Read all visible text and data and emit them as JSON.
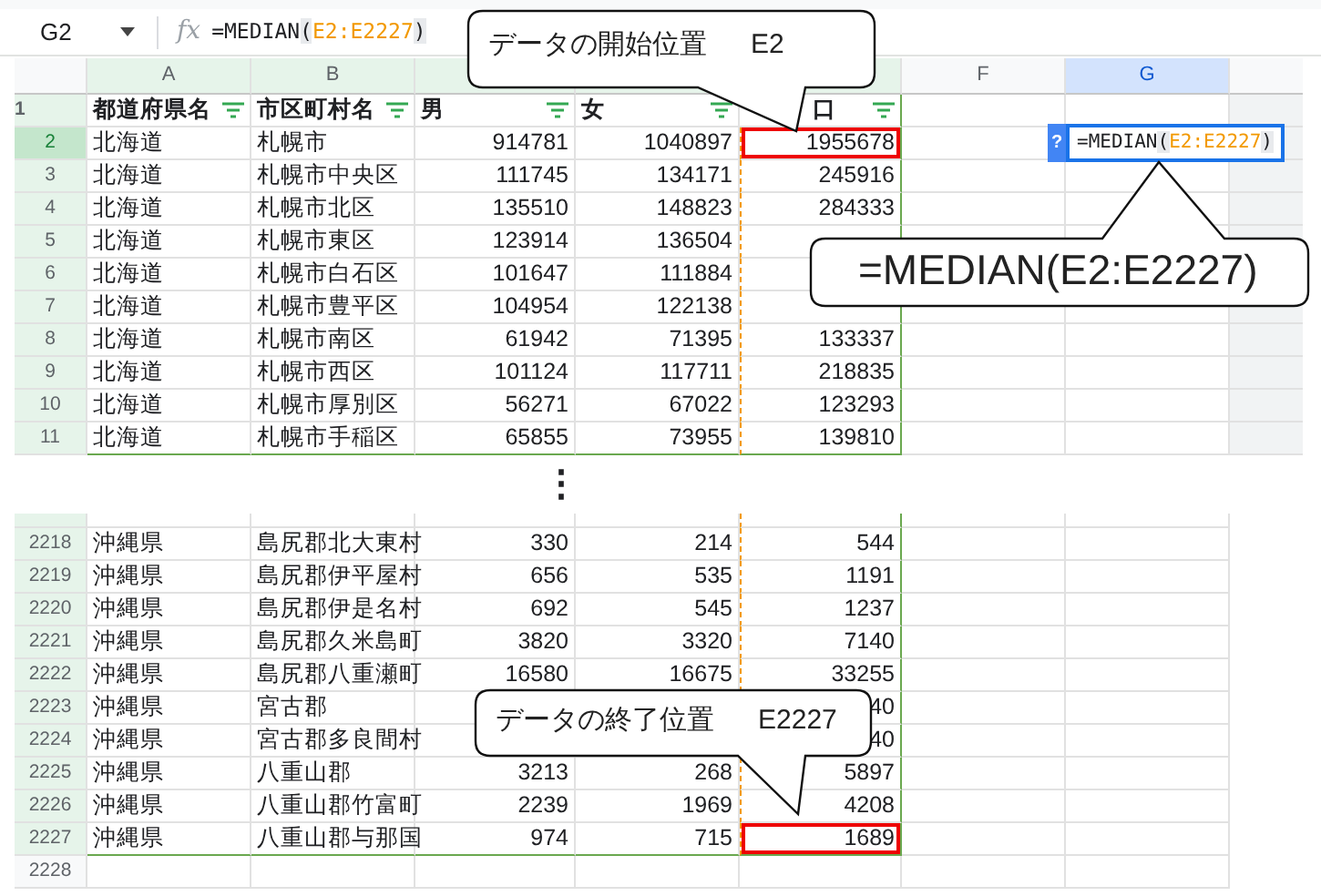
{
  "formula_bar": {
    "cell_ref": "G2",
    "fx": "fx",
    "formula": [
      {
        "text": "=MEDIAN",
        "kind": "plain"
      },
      {
        "text": "(",
        "kind": "paren"
      },
      {
        "text": "E2:E2227",
        "kind": "range"
      },
      {
        "text": ")",
        "kind": "paren"
      }
    ]
  },
  "sheet": {
    "columns": [
      {
        "letter": "A",
        "kind": "text",
        "filter": true,
        "selected": false,
        "in_range": false
      },
      {
        "letter": "B",
        "kind": "text",
        "filter": true,
        "selected": false,
        "in_range": false
      },
      {
        "kind": "number",
        "filter": true,
        "selected": false,
        "in_range": false
      },
      {
        "kind": "number",
        "filter": true,
        "selected": false,
        "in_range": false
      },
      {
        "kind": "number",
        "filter": true,
        "selected": false,
        "in_range": true
      },
      {
        "letter": "F",
        "kind": "text",
        "filter": false,
        "selected": false,
        "in_range": false
      },
      {
        "letter": "G",
        "kind": "text",
        "filter": false,
        "selected": true,
        "in_range": false
      }
    ],
    "upper_rows": [
      {
        "row": "1",
        "kind": "header",
        "selected": false,
        "filtered": true,
        "in_range": false,
        "target": false,
        "cells": [
          "都道府県名",
          "市区町村名",
          "男",
          "女",
          "口",
          null,
          null
        ]
      },
      {
        "row": "2",
        "kind": "data",
        "selected": true,
        "filtered": true,
        "in_range": true,
        "target": true,
        "cells": [
          "北海道",
          "札幌市",
          "914781",
          "1040897",
          "1955678",
          null,
          null
        ],
        "editor": {
          "hint": "?",
          "formula": [
            {
              "text": "=MEDIAN",
              "kind": "plain"
            },
            {
              "text": "(",
              "kind": "paren"
            },
            {
              "text": "E2:E2227",
              "kind": "range"
            },
            {
              "text": ")",
              "kind": "paren"
            }
          ]
        }
      },
      {
        "row": "3",
        "kind": "data",
        "selected": false,
        "filtered": true,
        "in_range": true,
        "target": false,
        "cells": [
          "北海道",
          "札幌市中央区",
          "111745",
          "134171",
          "245916",
          null,
          null
        ]
      },
      {
        "row": "4",
        "kind": "data",
        "selected": false,
        "filtered": true,
        "in_range": true,
        "target": false,
        "cells": [
          "北海道",
          "札幌市北区",
          "135510",
          "148823",
          "284333",
          null,
          null
        ]
      },
      {
        "row": "5",
        "kind": "data",
        "selected": false,
        "filtered": true,
        "in_range": true,
        "target": false,
        "cells": [
          "北海道",
          "札幌市東区",
          "123914",
          "136504",
          null,
          null,
          null
        ]
      },
      {
        "row": "6",
        "kind": "data",
        "selected": false,
        "filtered": true,
        "in_range": true,
        "target": false,
        "cells": [
          "北海道",
          "札幌市白石区",
          "101647",
          "111884",
          null,
          null,
          null
        ]
      },
      {
        "row": "7",
        "kind": "data",
        "selected": false,
        "filtered": true,
        "in_range": true,
        "target": false,
        "cells": [
          "北海道",
          "札幌市豊平区",
          "104954",
          "122138",
          null,
          null,
          null
        ]
      },
      {
        "row": "8",
        "kind": "data",
        "selected": false,
        "filtered": true,
        "in_range": true,
        "target": false,
        "cells": [
          "北海道",
          "札幌市南区",
          "61942",
          "71395",
          "133337",
          null,
          null
        ]
      },
      {
        "row": "9",
        "kind": "data",
        "selected": false,
        "filtered": true,
        "in_range": true,
        "target": false,
        "cells": [
          "北海道",
          "札幌市西区",
          "101124",
          "117711",
          "218835",
          null,
          null
        ]
      },
      {
        "row": "10",
        "kind": "data",
        "selected": false,
        "filtered": true,
        "in_range": true,
        "target": false,
        "cells": [
          "北海道",
          "札幌市厚別区",
          "56271",
          "67022",
          "123293",
          null,
          null
        ]
      },
      {
        "row": "11",
        "kind": "data",
        "selected": false,
        "filtered": true,
        "in_range": true,
        "target": false,
        "cells": [
          "北海道",
          "札幌市手稲区",
          "65855",
          "73955",
          "139810",
          null,
          null
        ]
      }
    ],
    "gap_mark": "⋮",
    "lower_rows": [
      {
        "row": "2218",
        "kind": "data",
        "selected": false,
        "filtered": true,
        "in_range": true,
        "target": false,
        "cells": [
          "沖縄県",
          "島尻郡北大東村",
          "330",
          "214",
          "544",
          null,
          null
        ]
      },
      {
        "row": "2219",
        "kind": "data",
        "selected": false,
        "filtered": true,
        "in_range": true,
        "target": false,
        "cells": [
          "沖縄県",
          "島尻郡伊平屋村",
          "656",
          "535",
          "1191",
          null,
          null
        ]
      },
      {
        "row": "2220",
        "kind": "data",
        "selected": false,
        "filtered": true,
        "in_range": true,
        "target": false,
        "cells": [
          "沖縄県",
          "島尻郡伊是名村",
          "692",
          "545",
          "1237",
          null,
          null
        ]
      },
      {
        "row": "2221",
        "kind": "data",
        "selected": false,
        "filtered": true,
        "in_range": true,
        "target": false,
        "cells": [
          "沖縄県",
          "島尻郡久米島町",
          "3820",
          "3320",
          "7140",
          null,
          null
        ]
      },
      {
        "row": "2222",
        "kind": "data",
        "selected": false,
        "filtered": true,
        "in_range": true,
        "target": false,
        "cells": [
          "沖縄県",
          "島尻郡八重瀬町",
          "16580",
          "16675",
          "33255",
          null,
          null
        ]
      },
      {
        "row": "2223",
        "kind": "data",
        "selected": false,
        "filtered": true,
        "in_range": true,
        "target": false,
        "cells": [
          "沖縄県",
          "宮古郡",
          null,
          null,
          "40",
          null,
          null
        ]
      },
      {
        "row": "2224",
        "kind": "data",
        "selected": false,
        "filtered": true,
        "in_range": true,
        "target": false,
        "cells": [
          "沖縄県",
          "宮古郡多良間村",
          null,
          null,
          "40",
          null,
          null
        ]
      },
      {
        "row": "2225",
        "kind": "data",
        "selected": false,
        "filtered": true,
        "in_range": true,
        "target": false,
        "cells": [
          "沖縄県",
          "八重山郡",
          "3213",
          "268",
          "5897",
          null,
          null
        ]
      },
      {
        "row": "2226",
        "kind": "data",
        "selected": false,
        "filtered": true,
        "in_range": true,
        "target": false,
        "cells": [
          "沖縄県",
          "八重山郡竹富町",
          "2239",
          "1969",
          "4208",
          null,
          null
        ]
      },
      {
        "row": "2227",
        "kind": "data",
        "selected": false,
        "filtered": true,
        "in_range": true,
        "target": true,
        "cells": [
          "沖縄県",
          "八重山郡与那国",
          "974",
          "715",
          "1689",
          null,
          null
        ]
      },
      {
        "row": "2228",
        "kind": "data",
        "selected": false,
        "filtered": false,
        "in_range": false,
        "target": false,
        "cells": [
          null,
          null,
          null,
          null,
          null,
          null,
          null
        ]
      }
    ]
  },
  "callouts": [
    {
      "label": "データの開始位置",
      "cell": "E2"
    },
    {
      "label": "=MEDIAN(E2:E2227)"
    },
    {
      "label": "データの終了位置",
      "cell": "E2227"
    }
  ]
}
